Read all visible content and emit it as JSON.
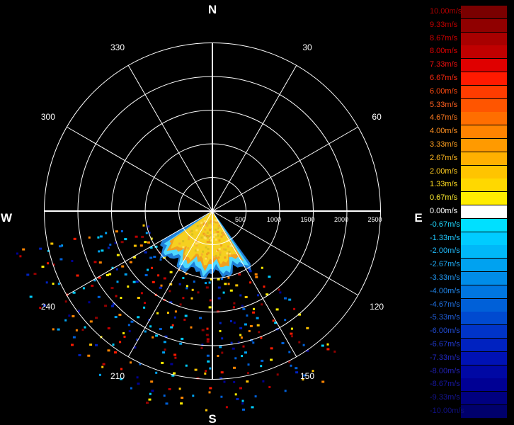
{
  "radar": {
    "compass": {
      "north": "N",
      "south": "S",
      "east": "E",
      "west": "W"
    },
    "azimuth_labels": [
      {
        "deg": 30,
        "text": "30"
      },
      {
        "deg": 60,
        "text": "60"
      },
      {
        "deg": 120,
        "text": "120"
      },
      {
        "deg": 150,
        "text": "150"
      },
      {
        "deg": 210,
        "text": "210"
      },
      {
        "deg": 240,
        "text": "240"
      },
      {
        "deg": 300,
        "text": "300"
      },
      {
        "deg": 330,
        "text": "330"
      }
    ],
    "range_labels": [
      "500",
      "1000",
      "1500",
      "2000",
      "2500"
    ],
    "grid_color": "#ffffff",
    "echo_colors": {
      "core": "#f5d020",
      "core_edge": "#f0a020",
      "rim_light": "#4fd8ff",
      "rim_dark": "#1f7fd8"
    }
  },
  "legend": {
    "entries": [
      {
        "label": "10.00m/s",
        "swatch": "#7a0000",
        "text_color": "#b00000"
      },
      {
        "label": "9.33m/s",
        "swatch": "#900000",
        "text_color": "#c00000"
      },
      {
        "label": "8.67m/s",
        "swatch": "#a80000",
        "text_color": "#d00000"
      },
      {
        "label": "8.00m/s",
        "swatch": "#c00000",
        "text_color": "#e00000"
      },
      {
        "label": "7.33m/s",
        "swatch": "#e00000",
        "text_color": "#ee1010"
      },
      {
        "label": "6.67m/s",
        "swatch": "#ff1a00",
        "text_color": "#ff2a10"
      },
      {
        "label": "6.00m/s",
        "swatch": "#ff3c00",
        "text_color": "#ff4a10"
      },
      {
        "label": "5.33m/s",
        "swatch": "#ff5500",
        "text_color": "#ff6020"
      },
      {
        "label": "4.67m/s",
        "swatch": "#ff6e00",
        "text_color": "#ff7a20"
      },
      {
        "label": "4.00m/s",
        "swatch": "#ff8400",
        "text_color": "#ff9020"
      },
      {
        "label": "3.33m/s",
        "swatch": "#ff9a00",
        "text_color": "#ffa020"
      },
      {
        "label": "2.67m/s",
        "swatch": "#ffb000",
        "text_color": "#ffb820"
      },
      {
        "label": "2.00m/s",
        "swatch": "#ffc400",
        "text_color": "#ffcc20"
      },
      {
        "label": "1.33m/s",
        "swatch": "#ffd800",
        "text_color": "#ffdc20"
      },
      {
        "label": "0.67m/s",
        "swatch": "#ffec00",
        "text_color": "#ffee30"
      },
      {
        "label": "0.00m/s",
        "swatch": "#ffffff",
        "text_color": "#ffffff"
      },
      {
        "label": "-0.67m/s",
        "swatch": "#00e0ff",
        "text_color": "#20d8ff"
      },
      {
        "label": "-1.33m/s",
        "swatch": "#00ccff",
        "text_color": "#20c8ff"
      },
      {
        "label": "-2.00m/s",
        "swatch": "#00b8f8",
        "text_color": "#20b8f8"
      },
      {
        "label": "-2.67m/s",
        "swatch": "#00a2f0",
        "text_color": "#20a8f0"
      },
      {
        "label": "-3.33m/s",
        "swatch": "#008ce8",
        "text_color": "#2096f0"
      },
      {
        "label": "-4.00m/s",
        "swatch": "#0076e0",
        "text_color": "#2084e8"
      },
      {
        "label": "-4.67m/s",
        "swatch": "#0060d8",
        "text_color": "#2070e0"
      },
      {
        "label": "-5.33m/s",
        "swatch": "#004ad0",
        "text_color": "#205ed8"
      },
      {
        "label": "-6.00m/s",
        "swatch": "#0034c8",
        "text_color": "#204ad0"
      },
      {
        "label": "-6.67m/s",
        "swatch": "#0022c0",
        "text_color": "#2038c8"
      },
      {
        "label": "-7.33m/s",
        "swatch": "#0012b4",
        "text_color": "#2028c0"
      },
      {
        "label": "-8.00m/s",
        "swatch": "#0008a4",
        "text_color": "#2020b0"
      },
      {
        "label": "-8.67m/s",
        "swatch": "#000094",
        "text_color": "#1818a0"
      },
      {
        "label": "-9.33m/s",
        "swatch": "#000080",
        "text_color": "#141490"
      },
      {
        "label": "-10.00m/s",
        "swatch": "#00006c",
        "text_color": "#101080"
      }
    ]
  }
}
